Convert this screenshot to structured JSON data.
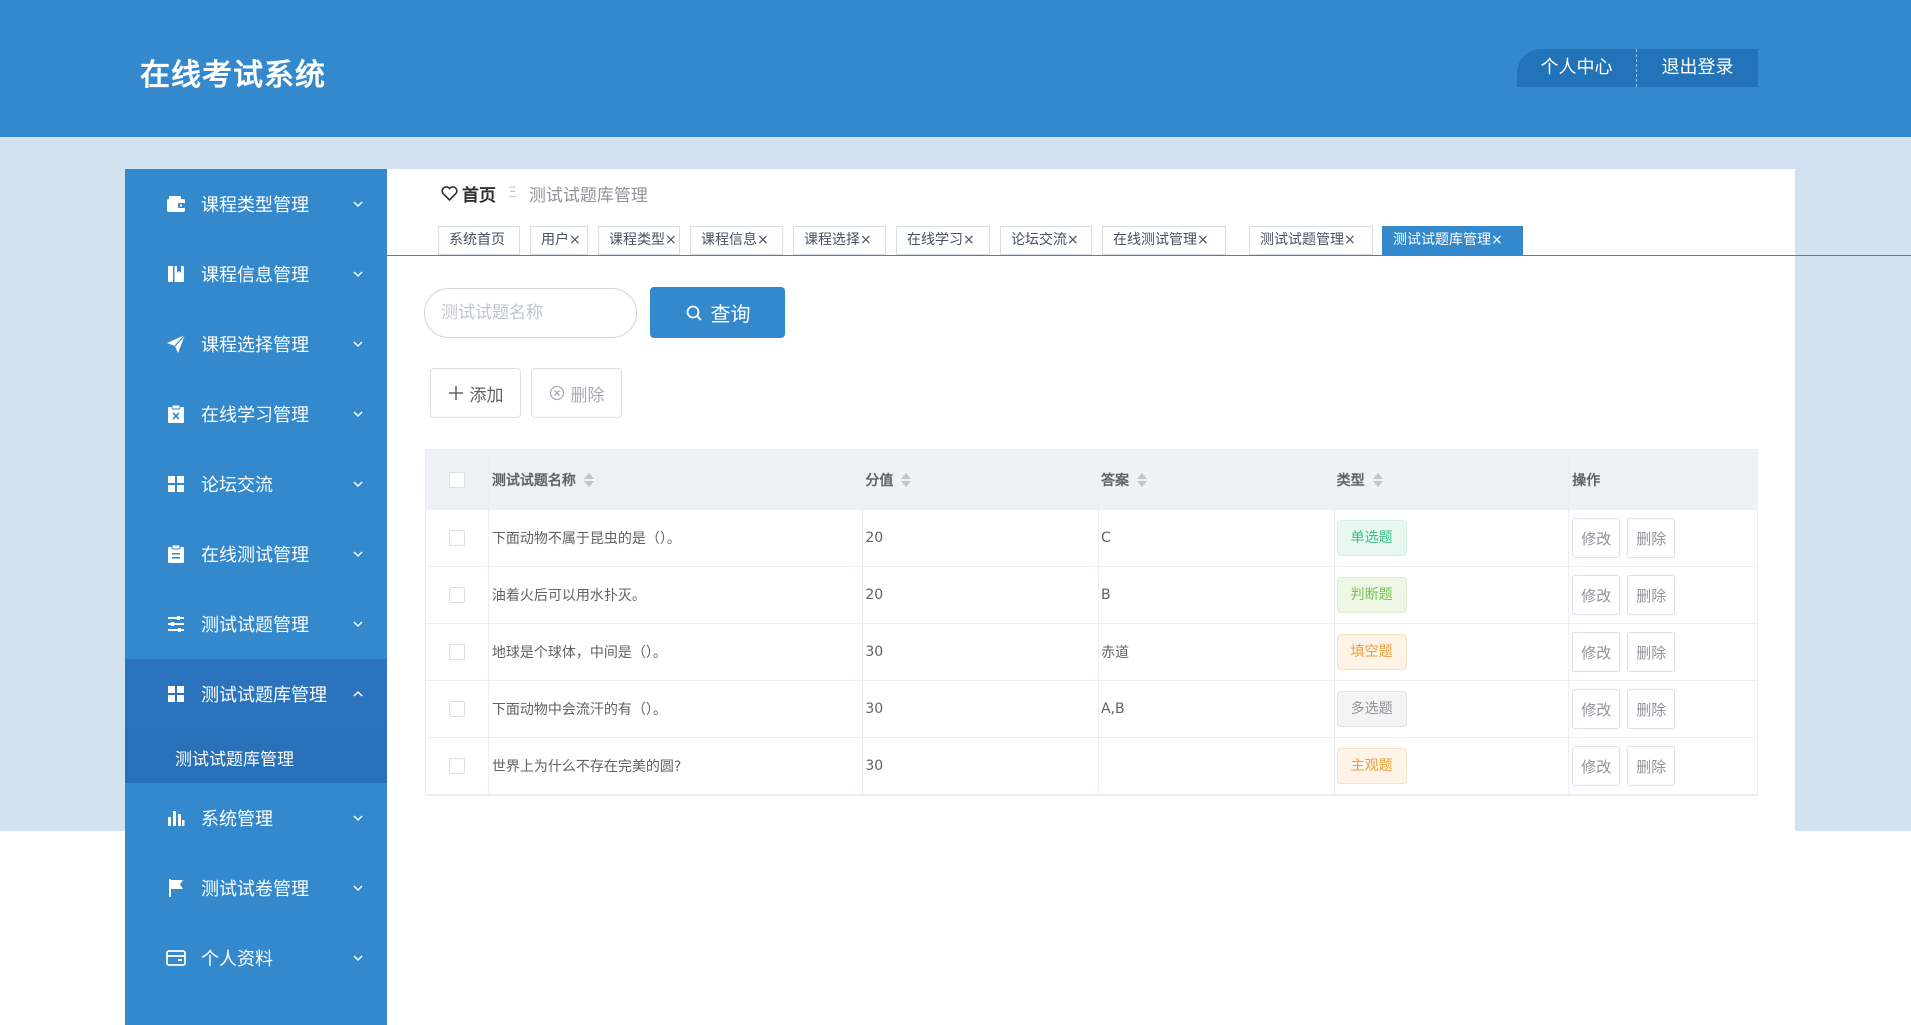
{
  "header": {
    "app_title": "在线考试系统",
    "personal_center": "个人中心",
    "logout": "退出登录",
    "brand_color": "#3489cd"
  },
  "sidebar": {
    "items": [
      {
        "label": "课程类型管理",
        "icon": "wallet-icon"
      },
      {
        "label": "课程信息管理",
        "icon": "book-icon"
      },
      {
        "label": "课程选择管理",
        "icon": "send-icon"
      },
      {
        "label": "在线学习管理",
        "icon": "clipboard-x-icon"
      },
      {
        "label": "论坛交流",
        "icon": "grid-icon"
      },
      {
        "label": "在线测试管理",
        "icon": "clipboard-icon"
      },
      {
        "label": "测试试题管理",
        "icon": "sliders-icon"
      },
      {
        "label": "测试试题库管理",
        "icon": "grid-icon",
        "expanded": true,
        "sub": [
          "测试试题库管理"
        ]
      },
      {
        "label": "系统管理",
        "icon": "bar-chart-icon"
      },
      {
        "label": "测试试卷管理",
        "icon": "flag-icon"
      },
      {
        "label": "个人资料",
        "icon": "card-icon"
      }
    ]
  },
  "breadcrumb": {
    "home": "首页",
    "separator": "Ξ",
    "current": "测试试题库管理"
  },
  "tabs": [
    {
      "label": "系统首页",
      "closable": false
    },
    {
      "label": "用户",
      "closable": true
    },
    {
      "label": "课程类型",
      "closable": true
    },
    {
      "label": "课程信息",
      "closable": true
    },
    {
      "label": "课程选择",
      "closable": true
    },
    {
      "label": "在线学习",
      "closable": true
    },
    {
      "label": "论坛交流",
      "closable": true
    },
    {
      "label": "在线测试管理",
      "closable": true
    },
    {
      "label": "测试试题管理",
      "closable": true
    },
    {
      "label": "测试试题库管理",
      "closable": true,
      "active": true
    }
  ],
  "search": {
    "placeholder": "测试试题名称",
    "value": "",
    "button": "查询"
  },
  "actions": {
    "add": "添加",
    "delete": "删除"
  },
  "table": {
    "columns": [
      "测试试题名称",
      "分值",
      "答案",
      "类型",
      "操作"
    ],
    "rows": [
      {
        "name": "下面动物不属于昆虫的是（）。",
        "score": "20",
        "answer": "C",
        "type": "单选题",
        "type_style": "single"
      },
      {
        "name": "油着火后可以用水扑灭。",
        "score": "20",
        "answer": "B",
        "type": "判断题",
        "type_style": "judge"
      },
      {
        "name": "地球是个球体，中间是（）。",
        "score": "30",
        "answer": "赤道",
        "type": "填空题",
        "type_style": "fill"
      },
      {
        "name": "下面动物中会流汗的有（）。",
        "score": "30",
        "answer": "A,B",
        "type": "多选题",
        "type_style": "multi"
      },
      {
        "name": "世界上为什么不存在完美的圆?",
        "score": "30",
        "answer": "",
        "type": "主观题",
        "type_style": "subj"
      }
    ],
    "row_edit": "修改",
    "row_delete": "删除"
  }
}
